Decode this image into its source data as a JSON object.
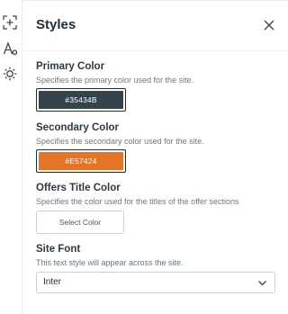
{
  "rail": {
    "icons": [
      "crop-add-icon",
      "font-style-icon",
      "gear-icon"
    ]
  },
  "header": {
    "title": "Styles"
  },
  "primary": {
    "label": "Primary Color",
    "description": "Specifies the primary color used for the site.",
    "value": "#35434B",
    "color": "#35434B"
  },
  "secondary": {
    "label": "Secondary Color",
    "description": "Specifies the secondary color used for the site.",
    "value": "#E57424",
    "color": "#E57424"
  },
  "offers": {
    "label": "Offers Title Color",
    "description": "Specifies the color used for the titles of the offer sections",
    "button": "Select Color"
  },
  "font": {
    "label": "Site Font",
    "description": "This text style will appear across the site.",
    "value": "Inter"
  }
}
